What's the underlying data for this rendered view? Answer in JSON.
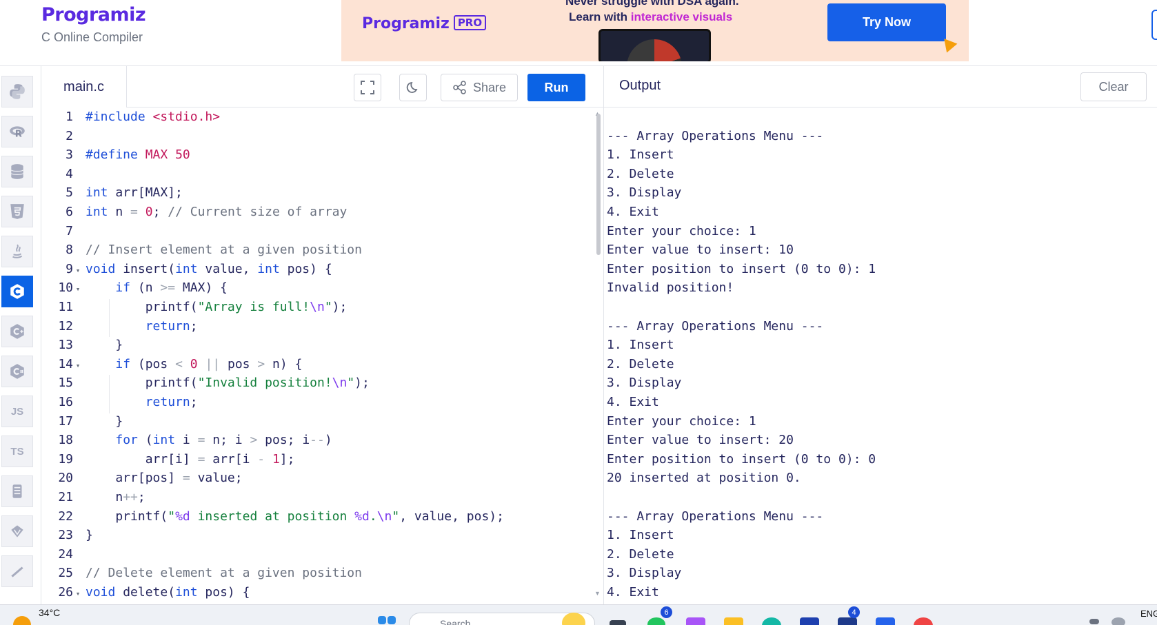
{
  "header": {
    "logo": "Programiz",
    "subtitle": "C Online Compiler",
    "ad": {
      "logo": "Programiz",
      "pro_badge": "PRO",
      "headline_top": "Never struggle with DSA again.",
      "headline_prefix": "Learn with ",
      "headline_highlight": "interactive visuals",
      "cta": "Try Now"
    }
  },
  "sidebar": {
    "languages": [
      {
        "name": "python",
        "label": ""
      },
      {
        "name": "r",
        "label": ""
      },
      {
        "name": "sql",
        "label": ""
      },
      {
        "name": "html",
        "label": ""
      },
      {
        "name": "java",
        "label": ""
      },
      {
        "name": "c",
        "label": "C",
        "active": true
      },
      {
        "name": "cpp",
        "label": ""
      },
      {
        "name": "csharp",
        "label": ""
      },
      {
        "name": "javascript",
        "label": "JS"
      },
      {
        "name": "typescript",
        "label": "TS"
      },
      {
        "name": "go",
        "label": ""
      },
      {
        "name": "php",
        "label": ""
      },
      {
        "name": "swift",
        "label": ""
      }
    ]
  },
  "editor": {
    "tab": "main.c",
    "share_label": "Share",
    "run_label": "Run",
    "lines": [
      "#include <stdio.h>",
      "",
      "#define MAX 50",
      "",
      "int arr[MAX];",
      "int n = 0; // Current size of array",
      "",
      "// Insert element at a given position",
      "void insert(int value, int pos) {",
      "    if (n >= MAX) {",
      "        printf(\"Array is full!\\n\");",
      "        return;",
      "    }",
      "    if (pos < 0 || pos > n) {",
      "        printf(\"Invalid position!\\n\");",
      "        return;",
      "    }",
      "    for (int i = n; i > pos; i--)",
      "        arr[i] = arr[i - 1];",
      "    arr[pos] = value;",
      "    n++;",
      "    printf(\"%d inserted at position %d.\\n\", value, pos);",
      "}",
      "",
      "// Delete element at a given position",
      "void delete(int pos) {"
    ],
    "fold_lines": [
      9,
      10,
      14,
      26
    ]
  },
  "output": {
    "title": "Output",
    "clear_label": "Clear",
    "lines": [
      "",
      "--- Array Operations Menu ---",
      "1. Insert",
      "2. Delete",
      "3. Display",
      "4. Exit",
      "Enter your choice: 1",
      "Enter value to insert: 10",
      "Enter position to insert (0 to 0): 1",
      "Invalid position!",
      "",
      "--- Array Operations Menu ---",
      "1. Insert",
      "2. Delete",
      "3. Display",
      "4. Exit",
      "Enter your choice: 1",
      "Enter value to insert: 20",
      "Enter position to insert (0 to 0): 0",
      "20 inserted at position 0.",
      "",
      "--- Array Operations Menu ---",
      "1. Insert",
      "2. Delete",
      "3. Display",
      "4. Exit"
    ]
  },
  "taskbar": {
    "temperature": "34°C",
    "search_placeholder": "Search",
    "badge_1": "6",
    "badge_2": "4",
    "language": "ENG"
  },
  "colors": {
    "accent": "#0b63e5",
    "brand": "#5a2ae0",
    "ad_background": "#fde3d4"
  }
}
